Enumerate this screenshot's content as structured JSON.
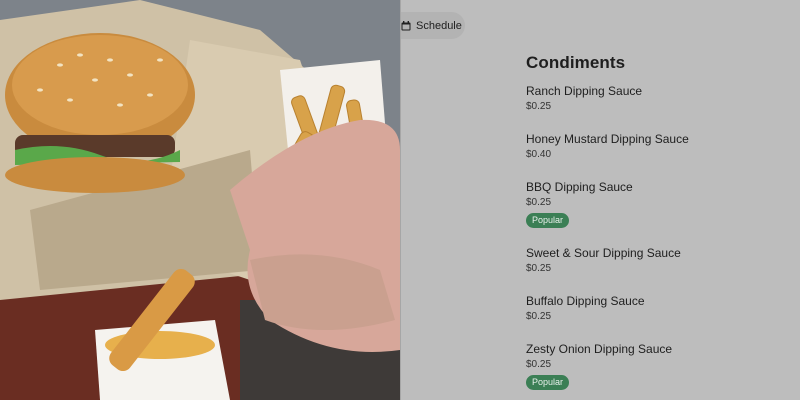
{
  "toolbar": {
    "schedule_label": "Schedule",
    "schedule_icon": "calendar-icon"
  },
  "menu": {
    "section_title": "Condiments",
    "items": [
      {
        "name": "Ranch Dipping Sauce",
        "price": "$0.25",
        "badge": ""
      },
      {
        "name": "Honey Mustard Dipping Sauce",
        "price": "$0.40",
        "badge": ""
      },
      {
        "name": "BBQ Dipping Sauce",
        "price": "$0.25",
        "badge": "Popular"
      },
      {
        "name": "Sweet & Sour Dipping Sauce",
        "price": "$0.25",
        "badge": ""
      },
      {
        "name": "Buffalo Dipping Sauce",
        "price": "$0.25",
        "badge": ""
      },
      {
        "name": "Zesty Onion Dipping Sauce",
        "price": "$0.25",
        "badge": "Popular"
      }
    ]
  },
  "colors": {
    "badge_bg": "#3b7f55",
    "pane_bg": "#bdbdbd"
  }
}
